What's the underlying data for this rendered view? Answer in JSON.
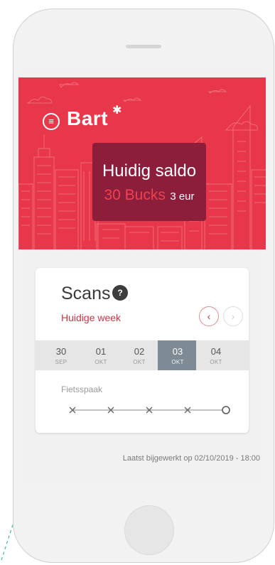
{
  "header": {
    "user_name": "Bart",
    "menu_icon": "hamburger-icon",
    "settings_icon": "gear-icon"
  },
  "balance": {
    "title": "Huidig saldo",
    "bucks": "30 Bucks",
    "eur": "3 eur"
  },
  "scans": {
    "title": "Scans",
    "help": "?",
    "week_label": "Huidige week",
    "prev": "‹",
    "next": "›",
    "days": [
      {
        "num": "30",
        "mon": "SEP",
        "active": false
      },
      {
        "num": "01",
        "mon": "OKT",
        "active": false
      },
      {
        "num": "02",
        "mon": "OKT",
        "active": false
      },
      {
        "num": "03",
        "mon": "OKT",
        "active": true
      },
      {
        "num": "04",
        "mon": "OKT",
        "active": false
      }
    ],
    "tracker_label": "Fietsspaak",
    "tracker": [
      "x",
      "x",
      "x",
      "x",
      "o"
    ]
  },
  "footer": {
    "updated": "Laatst bijgewerkt op 02/10/2019 - 18:00"
  },
  "colors": {
    "brand_red": "#e8374a",
    "balance_bg": "#8d1e3b",
    "active_day": "#7e8b95"
  }
}
